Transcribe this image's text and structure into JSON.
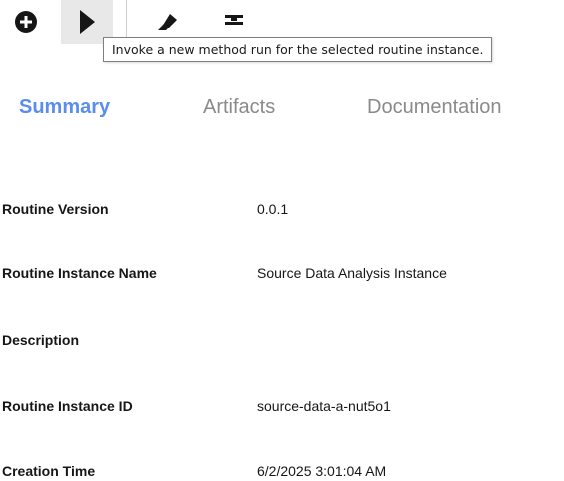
{
  "toolbar": {
    "icons": {
      "add": "plus-circle-icon",
      "run": "play-icon",
      "clear": "eraser-icon",
      "format": "strikethrough-icon"
    },
    "tooltip": "Invoke a new method run for the selected routine instance."
  },
  "tabs": {
    "summary": "Summary",
    "artifacts": "Artifacts",
    "documentation": "Documentation",
    "active": "Summary",
    "active_color": "#5b8def",
    "inactive_color": "#8a8a8a"
  },
  "details": {
    "routine_version": {
      "label": "Routine Version",
      "value": "0.0.1"
    },
    "instance_name": {
      "label": "Routine Instance Name",
      "value": "Source Data Analysis Instance"
    },
    "description": {
      "label": "Description",
      "value": ""
    },
    "instance_id": {
      "label": "Routine Instance ID",
      "value": "source-data-a-nut5o1"
    },
    "creation_time": {
      "label": "Creation Time",
      "value": "6/2/2025 3:01:04 AM"
    }
  }
}
